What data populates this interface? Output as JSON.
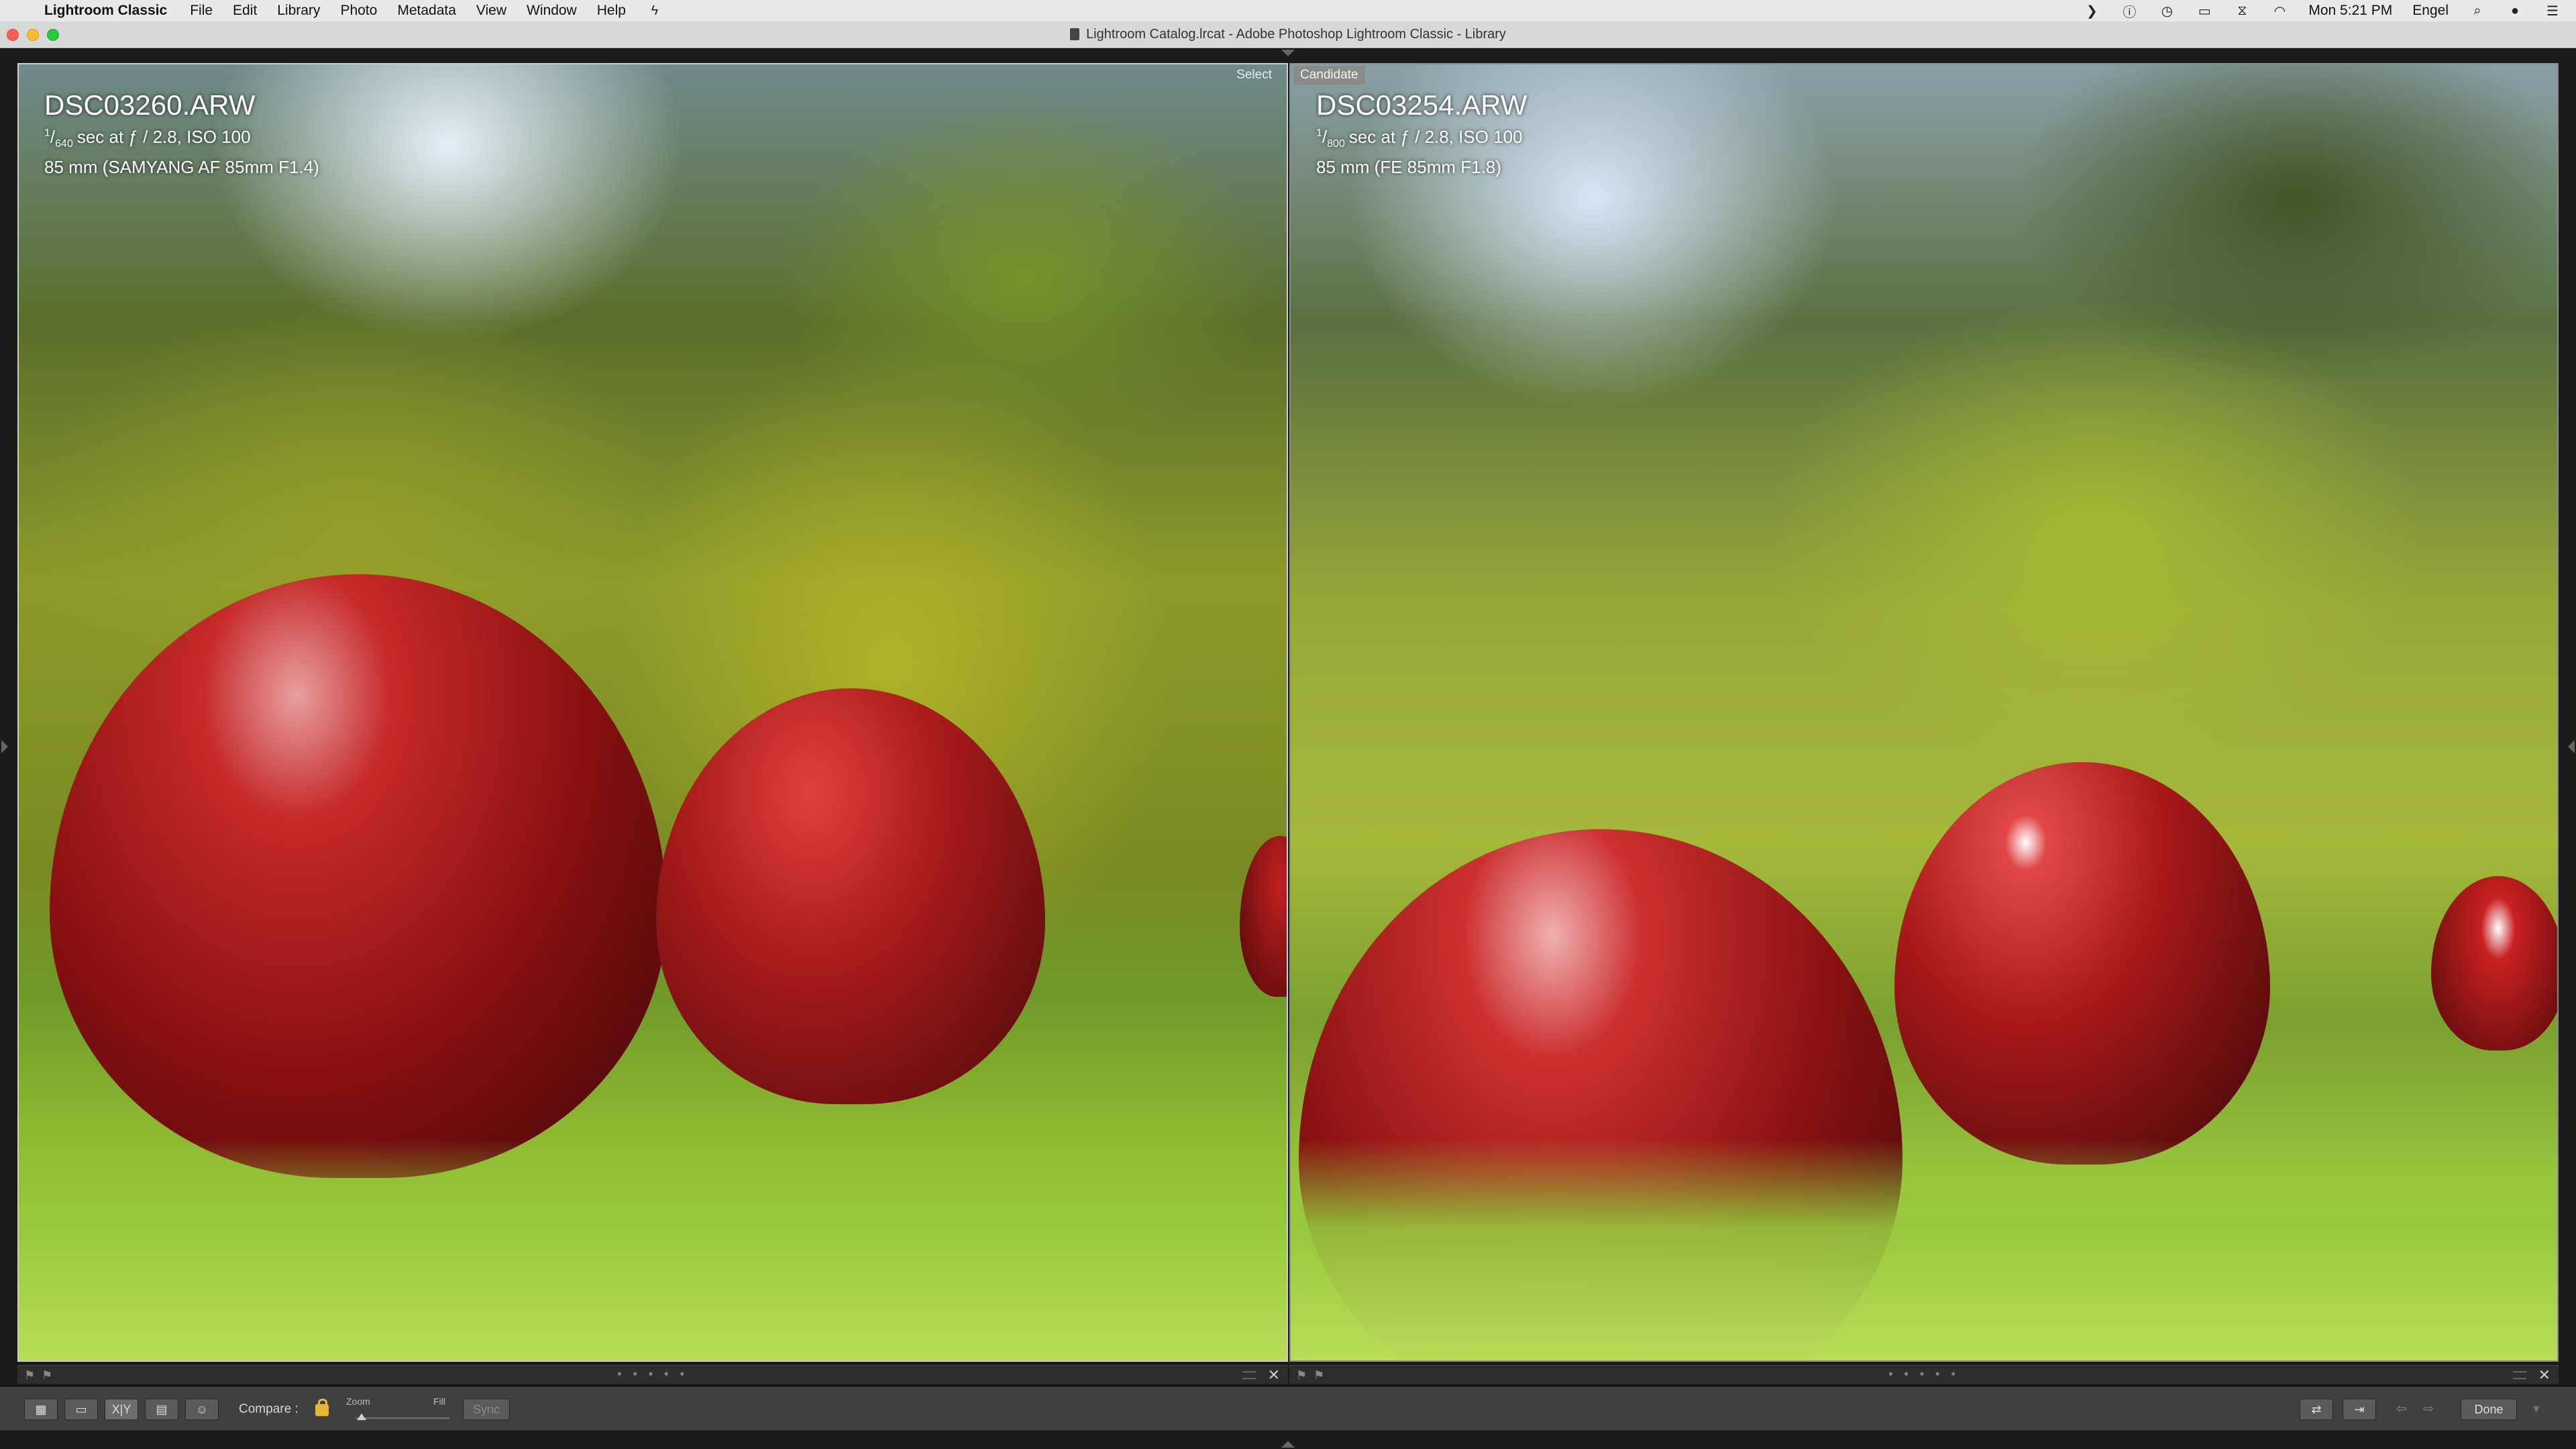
{
  "menubar": {
    "app_name": "Lightroom Classic",
    "menus": [
      "File",
      "Edit",
      "Library",
      "Photo",
      "Metadata",
      "View",
      "Window",
      "Help"
    ],
    "clock": "Mon 5:21 PM",
    "user": "Engel"
  },
  "window": {
    "title": "Lightroom Catalog.lrcat - Adobe Photoshop Lightroom Classic - Library"
  },
  "compare": {
    "select": {
      "badge": "Select",
      "filename": "DSC03260.ARW",
      "shutter_num": "1",
      "shutter_den": "640",
      "exposure": "sec at ƒ / 2.8, ISO 100",
      "lens": "85 mm (SAMYANG AF 85mm F1.4)"
    },
    "candidate": {
      "badge": "Candidate",
      "filename": "DSC03254.ARW",
      "shutter_num": "1",
      "shutter_den": "800",
      "exposure": "sec at ƒ / 2.8, ISO 100",
      "lens": "85 mm (FE 85mm F1.8)"
    },
    "strip_dots": "• • • • •"
  },
  "toolbar": {
    "compare_label": "Compare :",
    "zoom_label": "Zoom",
    "fill_label": "Fill",
    "sync_label": "Sync",
    "done_label": "Done",
    "xy_label": "X|Y"
  },
  "colors": {
    "lock_accent": "#e2b737",
    "menubar_bg": "#e9e9e9",
    "toolbar_bg": "#404040"
  }
}
